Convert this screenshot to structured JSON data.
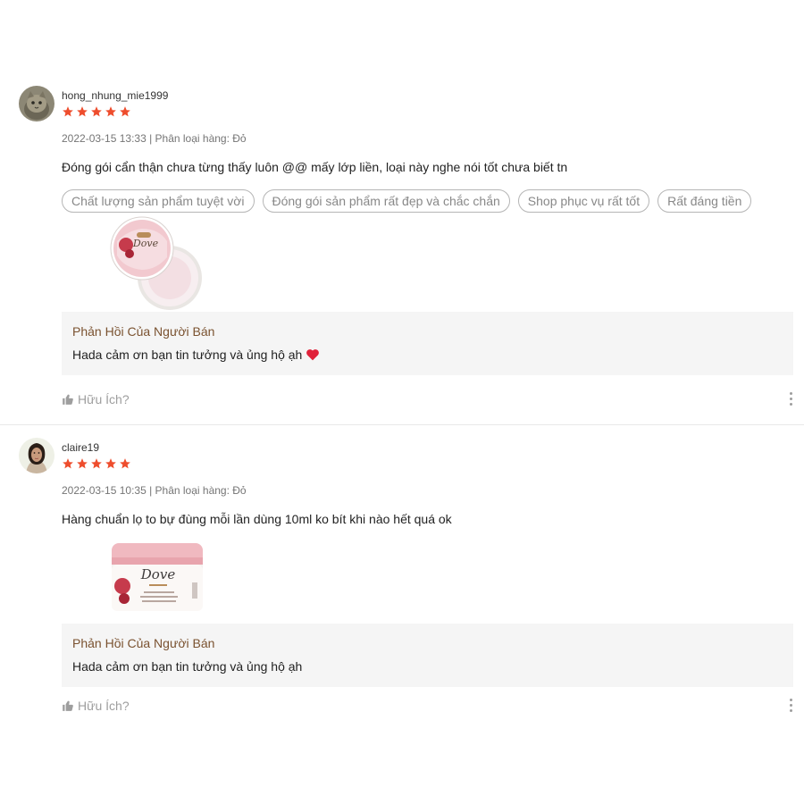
{
  "reviews": [
    {
      "username": "hong_nhung_mie1999",
      "rating": 5,
      "meta": "2022-03-15 13:33 | Phân loại hàng: Đỏ",
      "comment": "Đóng gói cẩn thận chưa từng thấy luôn @@ mấy lớp liền, loại này nghe nói tốt chưa biết tn",
      "tags": [
        "Chất lượng sản phẩm tuyệt vời",
        "Đóng gói sản phẩm rất đẹp và chắc chắn",
        "Shop phục vụ rất tốt",
        "Rất đáng tiền"
      ],
      "photo_brand": "Dove",
      "seller_reply_title": "Phản Hồi Của Người Bán",
      "seller_reply_text": "Hada cảm ơn bạn tin tưởng và ủng hộ ạh",
      "helpful_label": "Hữu Ích?"
    },
    {
      "username": "claire19",
      "rating": 5,
      "meta": "2022-03-15 10:35 | Phân loại hàng: Đỏ",
      "comment": "Hàng chuẩn lọ to bự đùng mỗi lần dùng 10ml ko bít khi nào hết quá ok",
      "photo_brand": "Dove",
      "seller_reply_title": "Phản Hồi Của Người Bán",
      "seller_reply_text": "Hada cảm ơn bạn tin tưởng và ủng hộ ạh",
      "helpful_label": "Hữu Ích?"
    }
  ],
  "colors": {
    "star": "#ee4d2d",
    "reply_title": "#7a5230",
    "reply_bg": "#f5f5f5",
    "heart": "#e0223a"
  }
}
